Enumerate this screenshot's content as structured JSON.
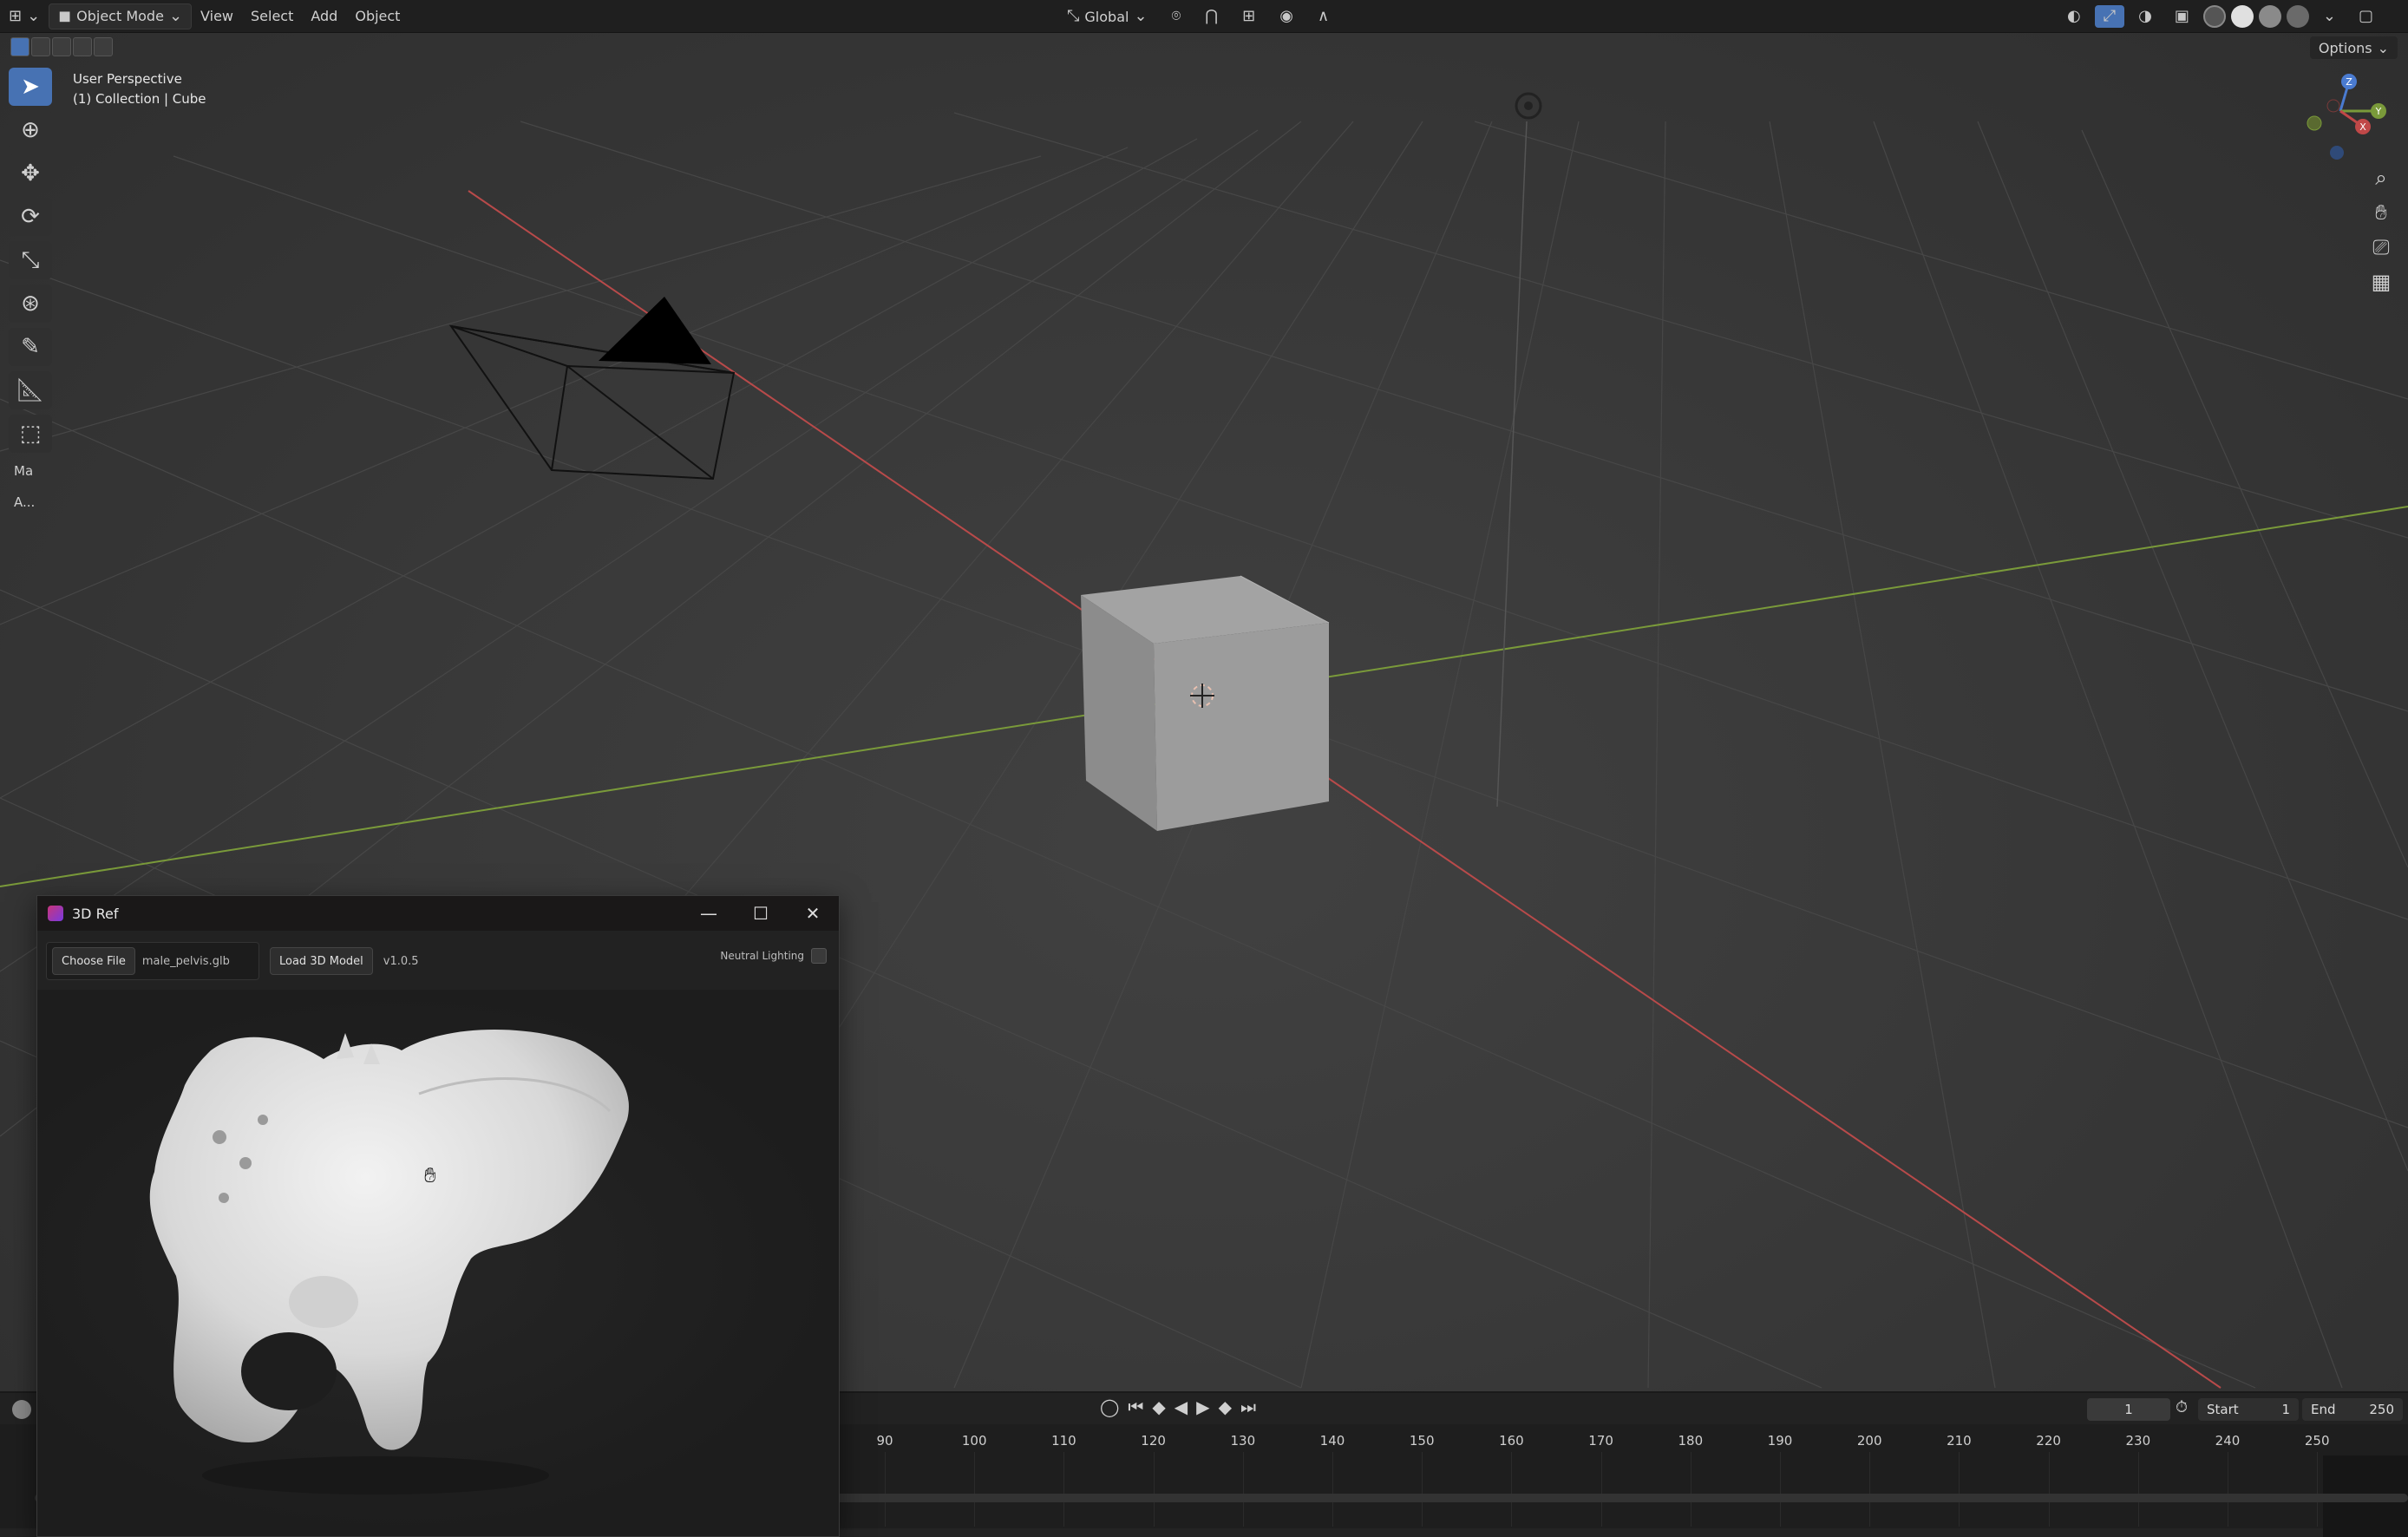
{
  "topbar": {
    "mode_label": "Object Mode",
    "menus": [
      "View",
      "Select",
      "Add",
      "Object"
    ],
    "orientation_label": "Global",
    "options_label": "Options"
  },
  "viewport": {
    "view_name": "User Perspective",
    "collection_label": "(1) Collection | Cube",
    "toolbar_extra_1": "Ma",
    "toolbar_extra_2": "A...",
    "axis_x": "X",
    "axis_y": "Y",
    "axis_z": "Z"
  },
  "timeline": {
    "current_frame": "1",
    "start_label": "Start",
    "start_value": "1",
    "end_label": "End",
    "end_value": "250",
    "ruler_ticks": [
      "90",
      "100",
      "110",
      "120",
      "130",
      "140",
      "150",
      "160",
      "170",
      "180",
      "190",
      "200",
      "210",
      "220",
      "230",
      "240",
      "250"
    ]
  },
  "ref_window": {
    "title": "3D Ref",
    "choose_file_label": "Choose File",
    "file_name": "male_pelvis.glb",
    "load_label": "Load 3D Model",
    "version": "v1.0.5",
    "neutral_lighting_label": "Neutral Lighting"
  },
  "colors": {
    "accent": "#4772b3",
    "x_axis": "#b84a4a",
    "y_axis": "#7a9a3a",
    "background": "#393939"
  }
}
